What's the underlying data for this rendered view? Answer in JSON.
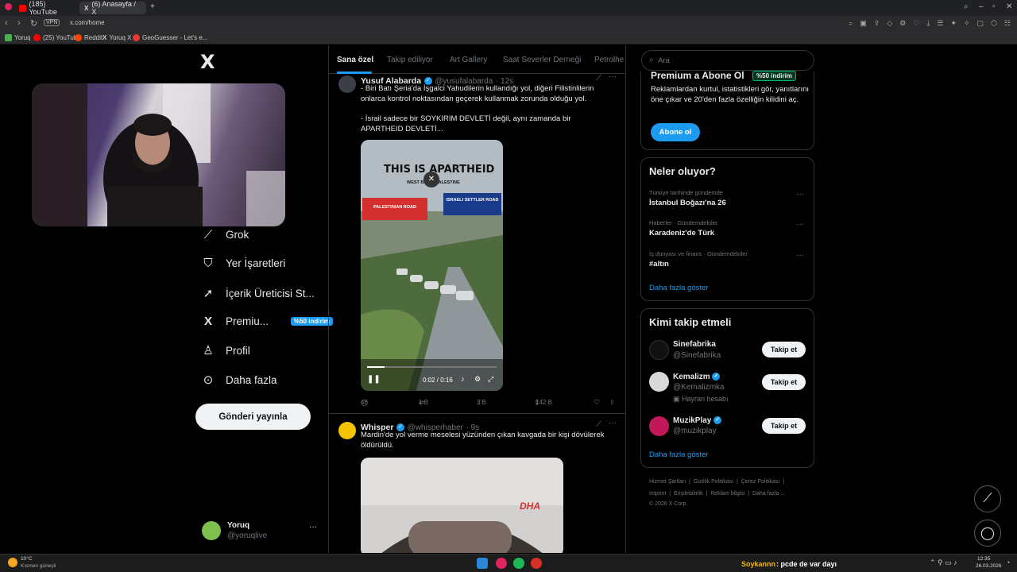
{
  "browser": {
    "tabs": [
      {
        "label": "(185) YouTube",
        "active": false
      },
      {
        "label": "(6) Anasayfa / X",
        "active": true
      }
    ],
    "new_tab_icon": "plus-icon",
    "url": "x.com/home",
    "vpn_label": "VPN",
    "bookmarks": [
      "Yoruq",
      "(25) YouTube",
      "Reddit",
      "Yoruq X",
      "GeoGuesser - Let's e..."
    ]
  },
  "sidebar": {
    "logo": "X",
    "items": [
      {
        "label": "Grok",
        "icon": "grok-icon"
      },
      {
        "label": "Yer İşaretleri",
        "icon": "bookmark-icon"
      },
      {
        "label": "İçerik Üreticisi St...",
        "icon": "rocket-icon"
      },
      {
        "label": "Premiu...",
        "icon": "x-premium-icon",
        "badge": "%50 indirim"
      },
      {
        "label": "Profil",
        "icon": "person-icon"
      },
      {
        "label": "Daha fazla",
        "icon": "more-circle-icon"
      }
    ],
    "post_button": "Gönderi yayınla",
    "profile": {
      "name": "Yoruq",
      "handle": "@yoruqlive"
    }
  },
  "feed": {
    "tabs": [
      "Sana özel",
      "Takip ediliyor",
      "Art Gallery",
      "Saat Severler Derneği",
      "Petrolhe"
    ],
    "tweets": [
      {
        "name": "Yusuf Alabarda",
        "handle": "@yusufalabarda",
        "time": "· 12s",
        "text1": "- Biri Batı Şeria'da İşgalci Yahudilerin kullandığı yol, diğeri Filistinlilerin onlarca kontrol noktasından geçerek kullanmak zorunda olduğu yol.",
        "text2": "- İsrail sadece bir SOYKIRIM DEVLETİ değil, aynı zamanda bir APARTHEID DEVLETİ...",
        "video": {
          "title": "THIS IS APARTHEID",
          "subtitle": "WEST BANK, PALESTINE",
          "label_left": "PALESTINIAN ROAD",
          "label_right": "ISRAELI SETTLER ROAD",
          "time": "0:02 / 0:16"
        },
        "replies": "46",
        "retweets": "1 B",
        "likes": "3 B",
        "views": "142 B"
      },
      {
        "name": "Whisper",
        "handle": "@whisperhaber",
        "time": "· 9s",
        "text1": "Mardin'de yol verme meselesi yüzünden çıkan kavgada bir kişi dövülerek öldürüldü.",
        "media_logo": "DHA"
      }
    ]
  },
  "right": {
    "search_placeholder": "Ara",
    "premium": {
      "title": "Premium a Abone Ol",
      "badge": "%50 indirim",
      "text": "Reklamlardan kurtul, istatistikleri gör, yanıtlarını öne çıkar ve 20'den fazla özelliğin kilidini aç.",
      "button": "Abone ol"
    },
    "trends": {
      "title": "Neler oluyor?",
      "items": [
        {
          "meta": "Türkiye tarihinde gündemde",
          "title": "İstanbul Boğazı'na 26"
        },
        {
          "meta": "Haberler · Gündemdekiler",
          "title": "Karadeniz'de Türk"
        },
        {
          "meta": "İş dünyası ve finans · Gündemdekiler",
          "title": "#altın"
        }
      ],
      "more": "Daha fazla göster"
    },
    "who_to_follow": {
      "title": "Kimi takip etmeli",
      "users": [
        {
          "name": "Sinefabrika",
          "handle": "@Sinefabrika",
          "note": "",
          "button": "Takip et"
        },
        {
          "name": "Kemalizm",
          "handle": "@Kemalizmka",
          "note": "Hayran hesabı",
          "button": "Takip et"
        },
        {
          "name": "MuzikPlay",
          "handle": "@muzikplay",
          "note": "",
          "button": "Takip et"
        }
      ],
      "more": "Daha fazla göster"
    },
    "footer": {
      "row1": [
        "Hizmet Şartları",
        "Gizlilik Politikası",
        "Çerez Politikası"
      ],
      "row2": [
        "Imprint",
        "Erişilebilirlik",
        "Reklam bilgisi",
        "Daha fazla ..."
      ],
      "copyright": "© 2026 X Corp."
    }
  },
  "taskbar": {
    "weather_temp": "10°C",
    "weather_desc": "Kısmen güneşli",
    "chat_user": "Soykannn",
    "chat_message": ": pcde de var dayı",
    "time": "12:35",
    "date": "26.03.2026"
  },
  "colors": {
    "accent": "#1d9bf0",
    "background": "#000000",
    "border": "#2f3336",
    "chat_user": "#f2b705"
  }
}
